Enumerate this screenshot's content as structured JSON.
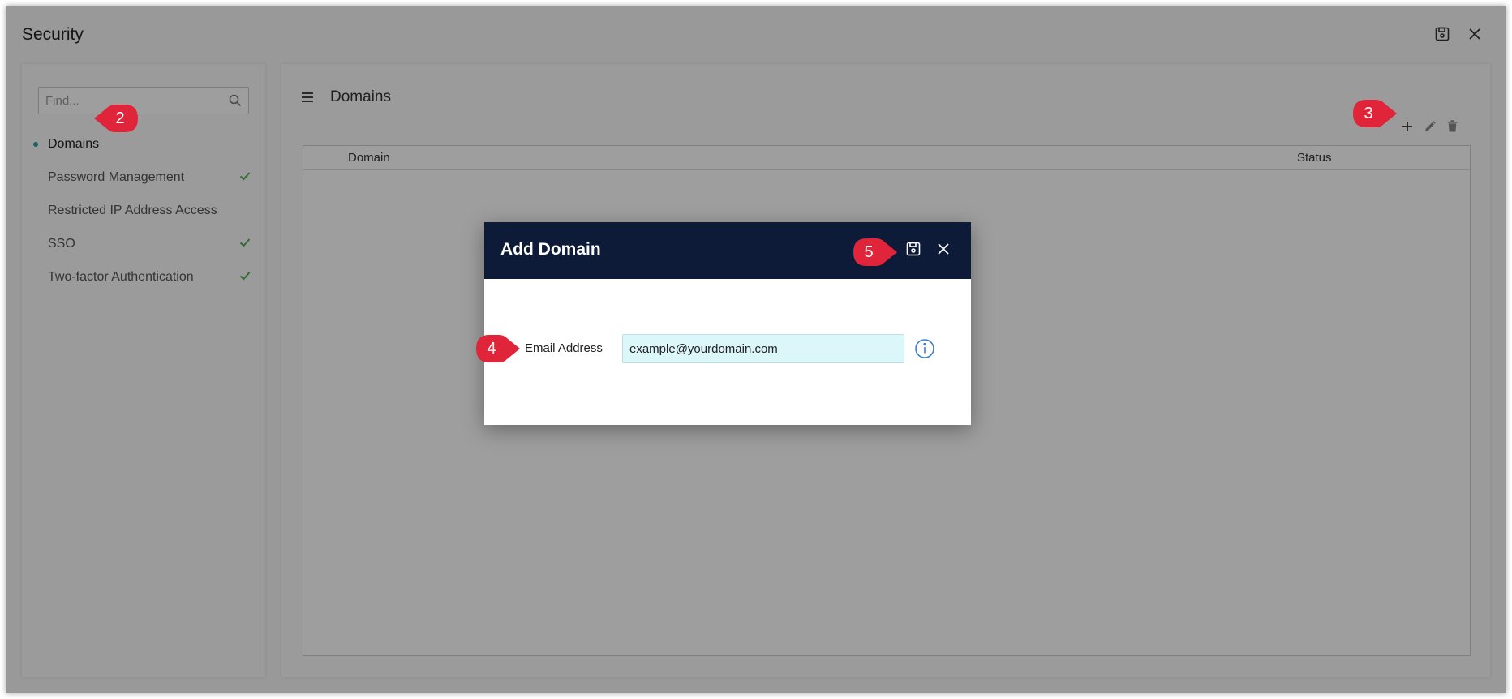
{
  "app": {
    "title": "Security"
  },
  "left": {
    "search_placeholder": "Find...",
    "items": [
      {
        "label": "Domains",
        "active": true,
        "checked": false
      },
      {
        "label": "Password Management",
        "active": false,
        "checked": true
      },
      {
        "label": "Restricted IP Address Access",
        "active": false,
        "checked": false
      },
      {
        "label": "SSO",
        "active": false,
        "checked": true
      },
      {
        "label": "Two-factor Authentication",
        "active": false,
        "checked": true
      }
    ]
  },
  "main": {
    "title": "Domains",
    "columns": [
      "Domain",
      "Status"
    ]
  },
  "modal": {
    "title": "Add Domain",
    "field_label": "Email Address",
    "field_value": "example@yourdomain.com"
  },
  "callouts": {
    "c2": "2",
    "c3": "3",
    "c4": "4",
    "c5": "5"
  },
  "colors": {
    "accent": "#2f9fa8",
    "check": "#4caf50",
    "modal_header": "#0d1b38",
    "callout": "#e0243a",
    "input_bg": "#dcf7fa"
  }
}
